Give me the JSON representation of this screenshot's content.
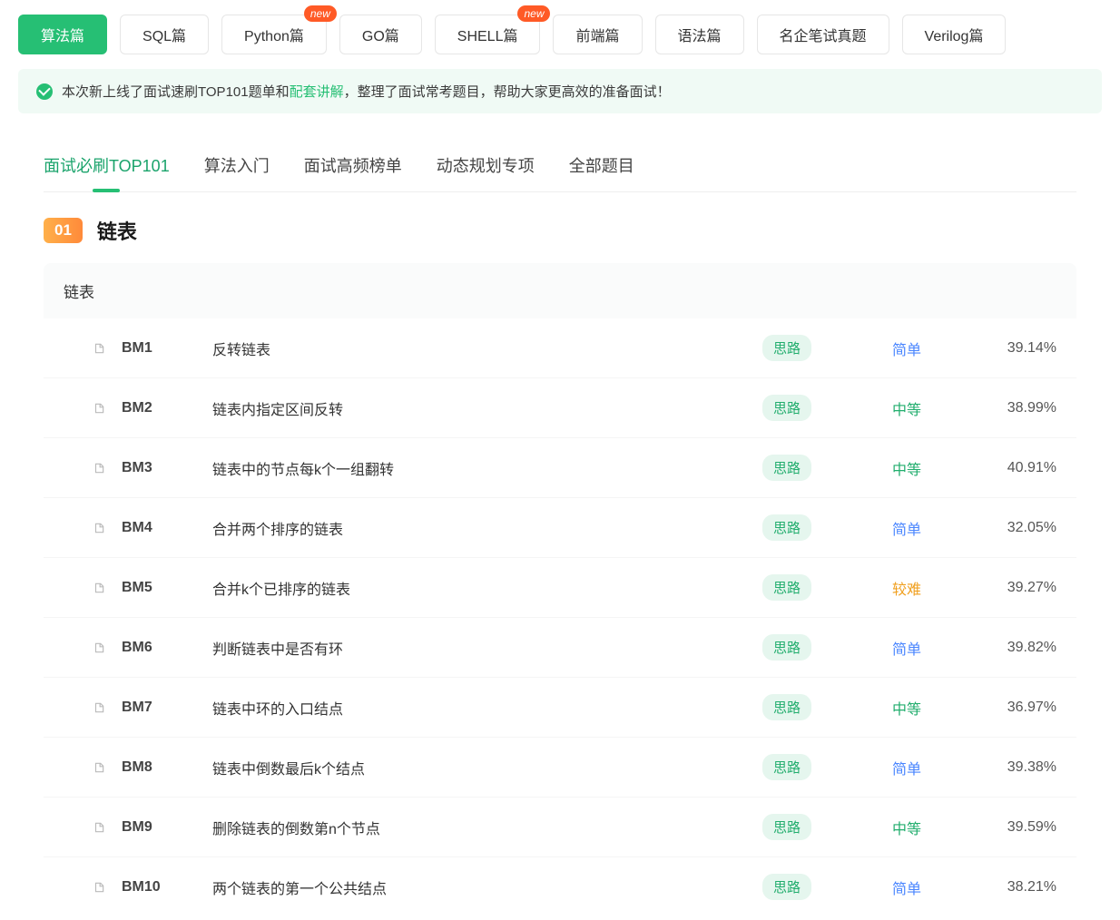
{
  "categories": [
    {
      "label": "算法篇",
      "active": true,
      "new": false
    },
    {
      "label": "SQL篇",
      "active": false,
      "new": false
    },
    {
      "label": "Python篇",
      "active": false,
      "new": true
    },
    {
      "label": "GO篇",
      "active": false,
      "new": false
    },
    {
      "label": "SHELL篇",
      "active": false,
      "new": true
    },
    {
      "label": "前端篇",
      "active": false,
      "new": false
    },
    {
      "label": "语法篇",
      "active": false,
      "new": false
    },
    {
      "label": "名企笔试真题",
      "active": false,
      "new": false
    },
    {
      "label": "Verilog篇",
      "active": false,
      "new": false
    }
  ],
  "new_badge_text": "new",
  "notice": {
    "text_pre": "本次新上线了面试速刷TOP101题单和",
    "link": "配套讲解",
    "text_post": "，整理了面试常考题目，帮助大家更高效的准备面试！"
  },
  "subnav": [
    {
      "label": "面试必刷TOP101",
      "active": true
    },
    {
      "label": "算法入门",
      "active": false
    },
    {
      "label": "面试高频榜单",
      "active": false
    },
    {
      "label": "动态规划专项",
      "active": false
    },
    {
      "label": "全部题目",
      "active": false
    }
  ],
  "section": {
    "num": "01",
    "title": "链表"
  },
  "group_title": "链表",
  "hint_label": "思路",
  "difficulty_labels": {
    "easy": "简单",
    "medium": "中等",
    "hard": "较难"
  },
  "problems": [
    {
      "code": "BM1",
      "title": "反转链表",
      "diff": "easy",
      "rate": "39.14%"
    },
    {
      "code": "BM2",
      "title": "链表内指定区间反转",
      "diff": "medium",
      "rate": "38.99%"
    },
    {
      "code": "BM3",
      "title": "链表中的节点每k个一组翻转",
      "diff": "medium",
      "rate": "40.91%"
    },
    {
      "code": "BM4",
      "title": "合并两个排序的链表",
      "diff": "easy",
      "rate": "32.05%"
    },
    {
      "code": "BM5",
      "title": "合并k个已排序的链表",
      "diff": "hard",
      "rate": "39.27%"
    },
    {
      "code": "BM6",
      "title": "判断链表中是否有环",
      "diff": "easy",
      "rate": "39.82%"
    },
    {
      "code": "BM7",
      "title": "链表中环的入口结点",
      "diff": "medium",
      "rate": "36.97%"
    },
    {
      "code": "BM8",
      "title": "链表中倒数最后k个结点",
      "diff": "easy",
      "rate": "39.38%"
    },
    {
      "code": "BM9",
      "title": "删除链表的倒数第n个节点",
      "diff": "medium",
      "rate": "39.59%"
    },
    {
      "code": "BM10",
      "title": "两个链表的第一个公共结点",
      "diff": "easy",
      "rate": "38.21%"
    }
  ]
}
